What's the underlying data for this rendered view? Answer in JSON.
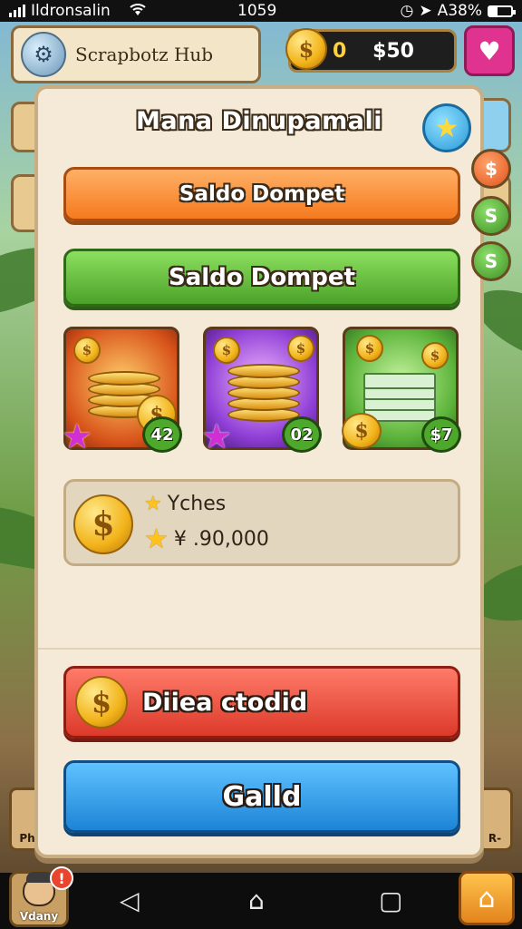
{
  "status_bar": {
    "carrier": "Ildronsalin",
    "time": "1059",
    "battery_text": "A38%",
    "battery_level": 0.38
  },
  "hud": {
    "hub_title": "Scrapbotz Hub",
    "currency_zero": "0",
    "currency_amount": "$50",
    "coin_symbol": "$"
  },
  "panel": {
    "title": "Mana Dinupamali",
    "side_chip_1": "$",
    "side_chip_2": "S",
    "side_chip_3": "S",
    "orange_button": "Saldo Dompet",
    "green_button": "Saldo Dompet",
    "tiles": [
      {
        "badge": "42",
        "coin": "$"
      },
      {
        "badge": "02",
        "coin": "$"
      },
      {
        "badge": "$7",
        "coin": "$"
      }
    ],
    "info": {
      "label": "Yches",
      "value": "¥ .90,000",
      "coin": "$"
    },
    "red_button": "Diiea ctodid",
    "blue_button": "Galld"
  },
  "bottom": {
    "avatar_name": "Vdany",
    "notification": "!",
    "side_left": "Ph",
    "side_right": "R-"
  },
  "colors": {
    "orange": "#f57a1e",
    "green": "#4ca12a",
    "red": "#dc3a2a",
    "blue": "#1d84d6",
    "panel": "#f4ead7"
  }
}
